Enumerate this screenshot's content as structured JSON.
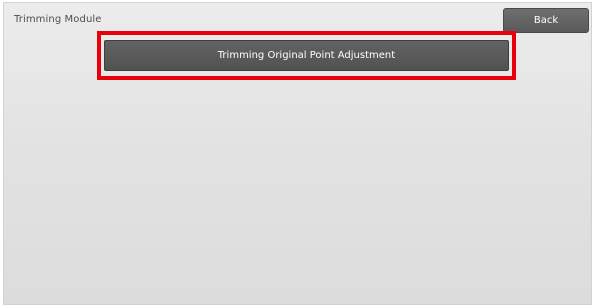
{
  "header": {
    "title": "Trimming Module",
    "back_label": "Back"
  },
  "main": {
    "buttons": [
      {
        "label": "Trimming Original Point Adjustment",
        "highlighted": true
      }
    ]
  },
  "colors": {
    "highlight": "#e8000b",
    "button": "#5a5a5a",
    "background": "#e3e3e3"
  }
}
